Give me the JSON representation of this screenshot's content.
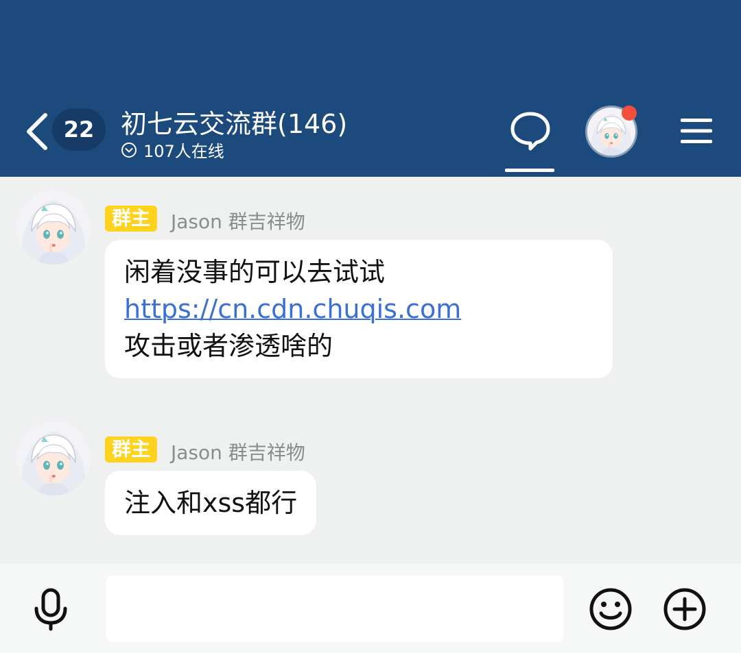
{
  "header": {
    "back_icon": "chevron-left-icon",
    "unread_count": "22",
    "title": "初七云交流群(146)",
    "online_icon": "chevron-down-circle-icon",
    "online_text": "107人在线",
    "chat_tab_icon": "chat-bubble-icon",
    "menu_icon": "hamburger-menu-icon",
    "avatar_has_notification": true,
    "background_color": "#1d4a7c",
    "notification_color": "#f2503c"
  },
  "messages": [
    {
      "role": "群主",
      "sender": "Jason 群吉祥物",
      "lines": [
        {
          "text": "闲着没事的可以去试试",
          "is_link": false
        },
        {
          "text": "https://cn.cdn.chuqis.com",
          "is_link": true
        },
        {
          "text": "攻击或者渗透啥的",
          "is_link": false
        }
      ]
    },
    {
      "role": "群主",
      "sender": "Jason 群吉祥物",
      "lines": [
        {
          "text": "注入和xss都行",
          "is_link": false
        }
      ]
    }
  ],
  "input_bar": {
    "mic_icon": "microphone-icon",
    "message_input_value": "",
    "emoji_icon": "smiley-emoji-icon",
    "plus_icon": "plus-circle-icon"
  },
  "colors": {
    "chat_background": "#eef1ef",
    "role_badge": "#ffd21e",
    "link": "#3a6fd4"
  }
}
